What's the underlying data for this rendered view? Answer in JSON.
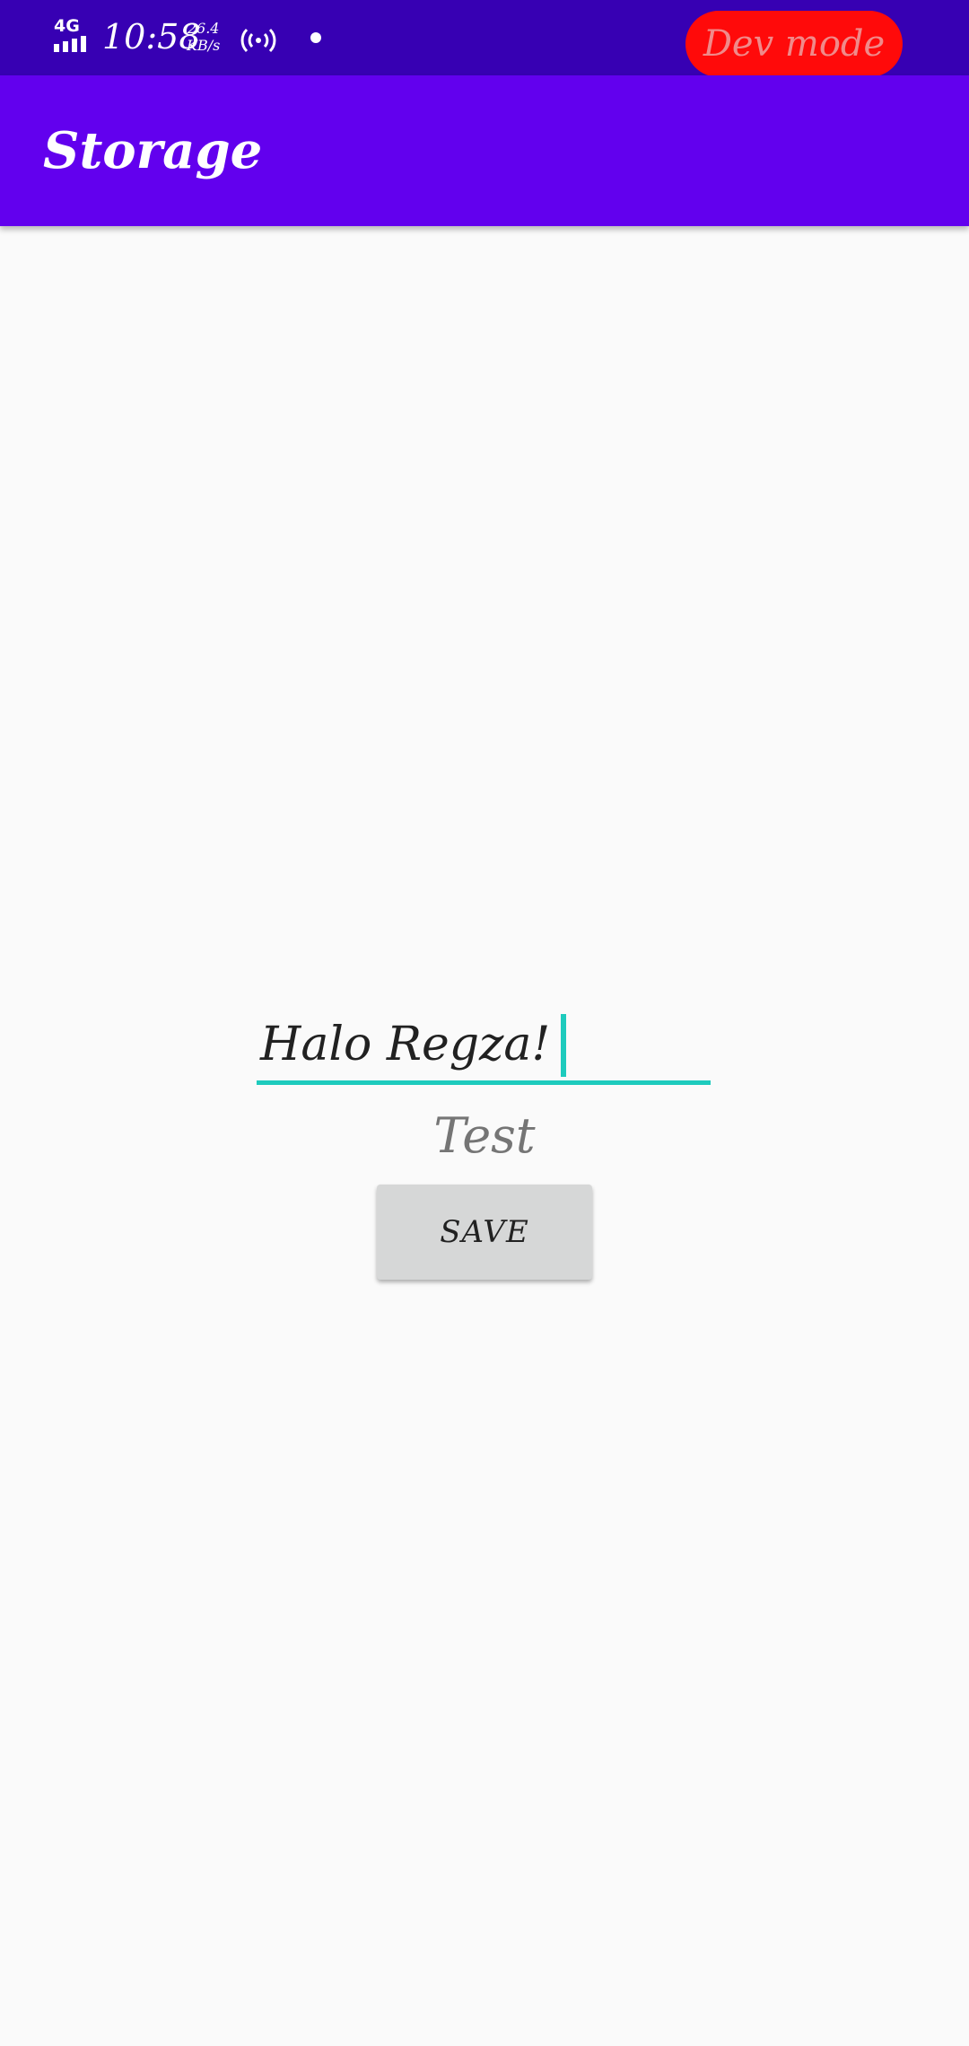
{
  "status_bar": {
    "network_type": "4G",
    "time": "10:58",
    "speed_value": "26.4",
    "speed_unit": "KB/s",
    "dev_badge": "Dev mode",
    "icons": [
      "signal-icon",
      "hotspot-icon",
      "notification-dot-icon"
    ],
    "colors": {
      "background": "#3700b3",
      "badge": "#ff0a0a"
    }
  },
  "app_bar": {
    "title": "Storage",
    "color": "#6200ee"
  },
  "form": {
    "input_value": "Halo Regza!",
    "label_text": "Test",
    "save_label": "SAVE",
    "accent_color": "#1ecbbd"
  }
}
